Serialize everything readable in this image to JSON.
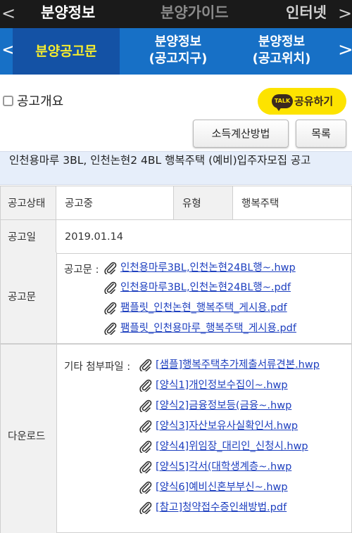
{
  "top_nav": {
    "left_arrow": "<",
    "right_arrow": ">",
    "tabs": [
      "분양정보",
      "분양가이드",
      "인터넷"
    ]
  },
  "sub_nav": {
    "left_arrow": "<",
    "right_arrow": ">",
    "tabs": [
      {
        "label": "분양공고문"
      },
      {
        "line1": "분양정보",
        "line2": "(공고지구)"
      },
      {
        "line1": "분양정보",
        "line2": "(공고위치)"
      }
    ]
  },
  "overview": {
    "title": "공고개요"
  },
  "share": {
    "icon_text": "TALK",
    "label": "공유하기"
  },
  "buttons": {
    "calc": "소득계산방법",
    "list": "목록"
  },
  "notice": {
    "title": "인천용마루 3BL, 인천논현2 4BL 행복주택 (예비)입주자모집 공고"
  },
  "info": {
    "status_label": "공고상태",
    "status_value": "공고중",
    "type_label": "유형",
    "type_value": "행복주택",
    "date_label": "공고일",
    "date_value": "2019.01.14",
    "notice_label": "공고문",
    "download_label": "다운로드"
  },
  "notice_files": {
    "label": "공고문 :",
    "files": [
      "인천용마루3BL,인천논현24BL행~.hwp",
      "인천용마루3BL,인천논현24BL행~.pdf",
      "팸플릿_인천논현_행복주택_게시용.pdf",
      "팸플릿_인천용마루_행복주택_게시용.pdf"
    ]
  },
  "attachments": {
    "label": "기타 첨부파일 :",
    "files": [
      "[샘플]행복주택추가제출서류견본.hwp",
      "[양식1]개인정보수집이~.hwp",
      "[양식2]금융정보등(금융~.hwp",
      "[양식3]자산보유사실확인서.hwp",
      "[양식4]위임장_대리인_신청시.hwp",
      "[양식5]각서(대학생계층~.hwp",
      "[양식6]예비신혼부부신~.hwp",
      "[참고]청약접수증인쇄방법.pdf"
    ]
  },
  "colors": {
    "top_bar": "#1a1a1a",
    "sub_bar": "#1770c6",
    "sub_active": "#1452a5",
    "sub_active_text": "#f5ec2e",
    "share_bg": "#fde300",
    "link": "#1d3fbf",
    "title_bg": "#e6eefa"
  },
  "icons": {
    "attachment": "paperclip-icon",
    "talk": "kakao-talk-icon"
  }
}
